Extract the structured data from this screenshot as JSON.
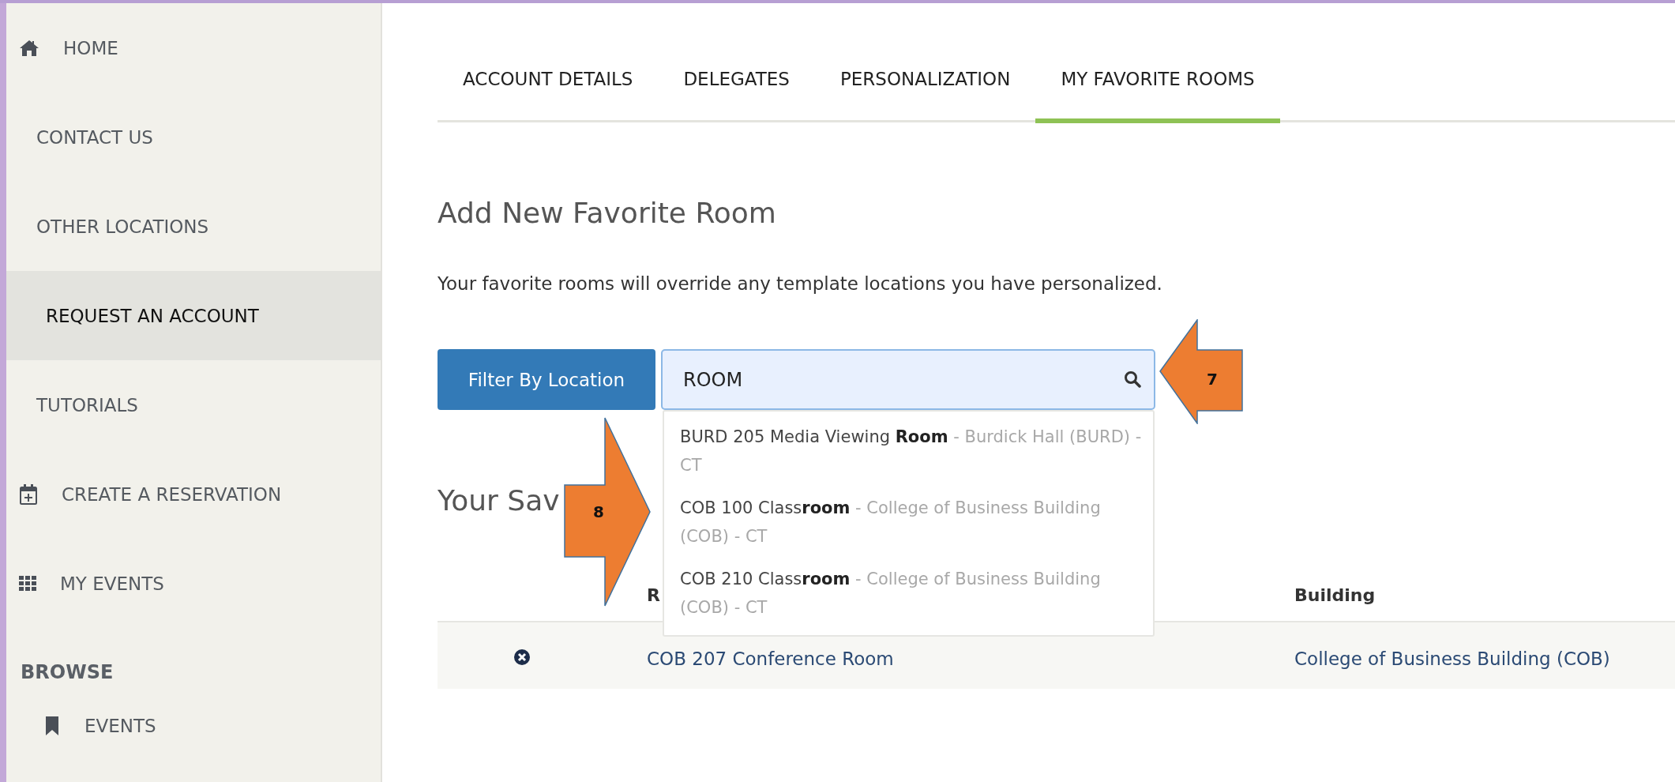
{
  "sidebar": {
    "items": [
      {
        "kind": "link",
        "label": "HOME",
        "selected": false
      },
      {
        "kind": "link",
        "label": "CONTACT US",
        "selected": false
      },
      {
        "kind": "link",
        "label": "OTHER LOCATIONS",
        "selected": false
      },
      {
        "kind": "link",
        "label": "REQUEST AN ACCOUNT",
        "selected": true
      },
      {
        "kind": "link",
        "label": "TUTORIALS",
        "selected": false
      },
      {
        "kind": "link",
        "label": "CREATE A RESERVATION",
        "selected": false
      },
      {
        "kind": "link",
        "label": "MY EVENTS",
        "selected": false
      },
      {
        "kind": "heading",
        "label": "BROWSE"
      },
      {
        "kind": "sublink",
        "label": "EVENTS",
        "selected": false
      }
    ]
  },
  "tabs": [
    {
      "label": "ACCOUNT DETAILS",
      "selected": false
    },
    {
      "label": "DELEGATES",
      "selected": false
    },
    {
      "label": "PERSONALIZATION",
      "selected": false
    },
    {
      "label": "MY FAVORITE ROOMS",
      "selected": true
    }
  ],
  "add_section": {
    "title": "Add New Favorite Room",
    "description": "Your favorite rooms will override any template locations you have personalized.",
    "filter_button": "Filter By Location",
    "search": {
      "value": "ROOM"
    },
    "suggestions": [
      {
        "name": "BURD 205 Media Viewing **Room**",
        "location": " - Burdick Hall (BURD) - CT"
      },
      {
        "name": "COB 100 Class**room**",
        "location": " - College of Business Building (COB) - CT"
      },
      {
        "name": "COB 210 Class**room**",
        "location": " - College of Business Building (COB) - CT"
      }
    ]
  },
  "saved_section": {
    "title": "Your Sav",
    "table": {
      "columns": [
        {
          "label": "R"
        },
        {
          "label": "Building"
        }
      ],
      "rows": [
        {
          "room": "COB 207 Conference Room",
          "building": "College of Business Building (COB)"
        }
      ]
    }
  },
  "callouts": [
    {
      "label": "7",
      "kind": "left-arrow"
    },
    {
      "label": "8",
      "kind": "right-arrow"
    }
  ]
}
